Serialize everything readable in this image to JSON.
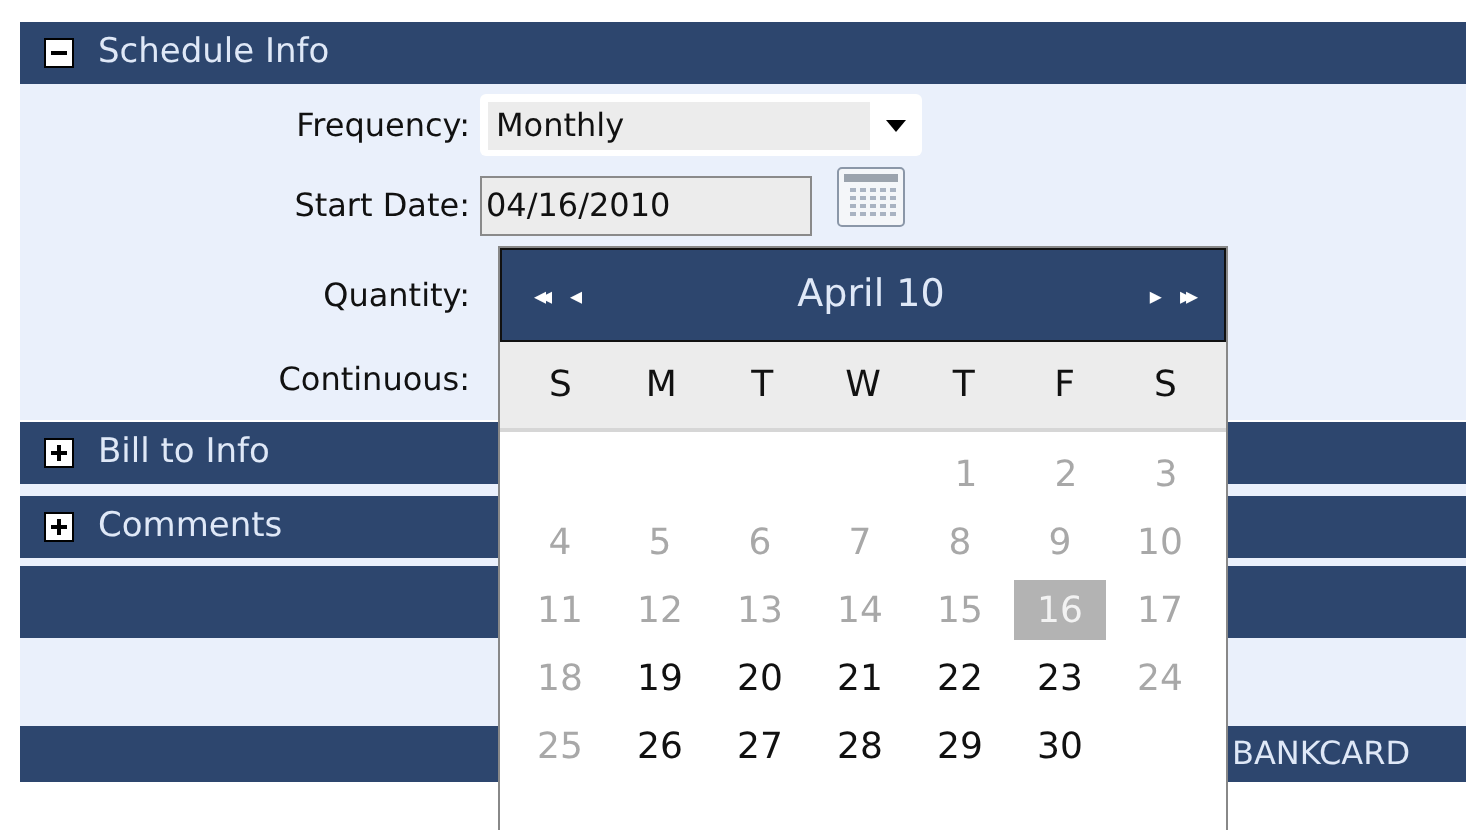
{
  "sections": [
    {
      "title": "Schedule Info",
      "expanded": true
    },
    {
      "title": "Bill to Info",
      "expanded": false
    },
    {
      "title": "Comments",
      "expanded": false
    }
  ],
  "form": {
    "frequency": {
      "label": "Frequency:",
      "value": "Monthly"
    },
    "start_date": {
      "label": "Start Date:",
      "value": "04/16/2010"
    },
    "quantity": {
      "label": "Quantity:"
    },
    "continuous": {
      "label": "Continuous:"
    }
  },
  "bottom_bar": {
    "text": "BANKCARD"
  },
  "calendar": {
    "title": "April 10",
    "nav": {
      "first": "◂◂",
      "prev": "◂",
      "next": "▸",
      "last": "▸▸"
    },
    "weekdays": [
      "S",
      "M",
      "T",
      "W",
      "T",
      "F",
      "S"
    ],
    "weeks": [
      [
        {
          "day": "1",
          "enabled": false,
          "selected": false
        },
        {
          "day": "2",
          "enabled": false,
          "selected": false
        },
        {
          "day": "3",
          "enabled": false,
          "selected": false
        }
      ],
      [
        {
          "day": "4",
          "enabled": false,
          "selected": false
        },
        {
          "day": "5",
          "enabled": false,
          "selected": false
        },
        {
          "day": "6",
          "enabled": false,
          "selected": false
        },
        {
          "day": "7",
          "enabled": false,
          "selected": false
        },
        {
          "day": "8",
          "enabled": false,
          "selected": false
        },
        {
          "day": "9",
          "enabled": false,
          "selected": false
        },
        {
          "day": "10",
          "enabled": false,
          "selected": false
        }
      ],
      [
        {
          "day": "11",
          "enabled": false,
          "selected": false
        },
        {
          "day": "12",
          "enabled": false,
          "selected": false
        },
        {
          "day": "13",
          "enabled": false,
          "selected": false
        },
        {
          "day": "14",
          "enabled": false,
          "selected": false
        },
        {
          "day": "15",
          "enabled": false,
          "selected": false
        },
        {
          "day": "16",
          "enabled": false,
          "selected": true
        },
        {
          "day": "17",
          "enabled": false,
          "selected": false
        }
      ],
      [
        {
          "day": "18",
          "enabled": false,
          "selected": false
        },
        {
          "day": "19",
          "enabled": true,
          "selected": false
        },
        {
          "day": "20",
          "enabled": true,
          "selected": false
        },
        {
          "day": "21",
          "enabled": true,
          "selected": false
        },
        {
          "day": "22",
          "enabled": true,
          "selected": false
        },
        {
          "day": "23",
          "enabled": true,
          "selected": false
        },
        {
          "day": "24",
          "enabled": false,
          "selected": false
        }
      ],
      [
        {
          "day": "25",
          "enabled": false,
          "selected": false
        },
        {
          "day": "26",
          "enabled": true,
          "selected": false
        },
        {
          "day": "27",
          "enabled": true,
          "selected": false
        },
        {
          "day": "28",
          "enabled": true,
          "selected": false
        },
        {
          "day": "29",
          "enabled": true,
          "selected": false
        },
        {
          "day": "30",
          "enabled": true,
          "selected": false
        }
      ]
    ]
  }
}
